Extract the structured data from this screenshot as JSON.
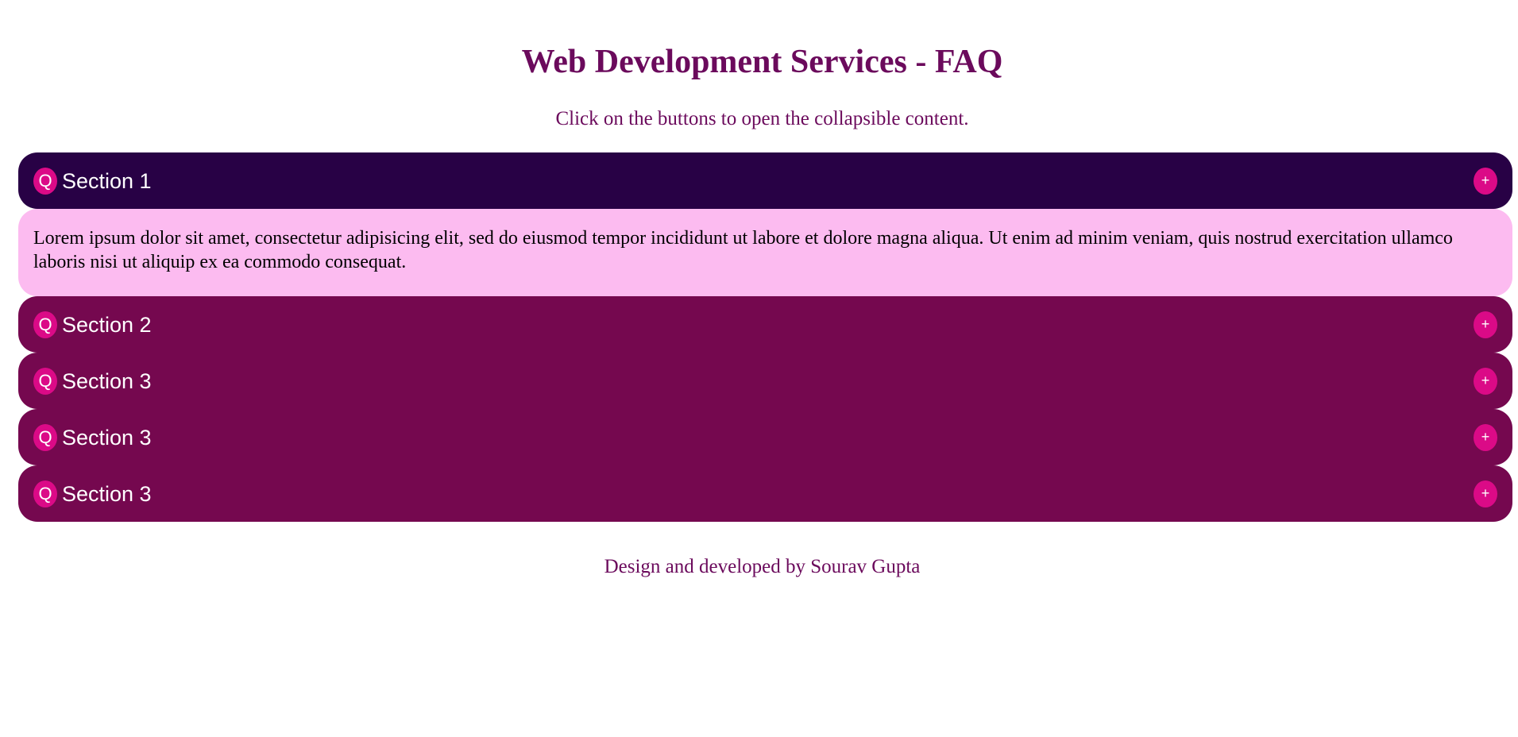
{
  "header": {
    "title": "Web Development Services - FAQ",
    "subtitle": "Click on the buttons to open the collapsible content."
  },
  "faq": {
    "q_icon_text": "Q",
    "toggle_icon_text": "+",
    "items": [
      {
        "label": "Section 1",
        "expanded": true,
        "content": "Lorem ipsum dolor sit amet, consectetur adipisicing elit, sed do eiusmod tempor incididunt ut labore et dolore magna aliqua. Ut enim ad minim veniam, quis nostrud exercitation ullamco laboris nisi ut aliquip ex ea commodo consequat."
      },
      {
        "label": "Section 2",
        "expanded": false
      },
      {
        "label": "Section 3",
        "expanded": false
      },
      {
        "label": "Section 3",
        "expanded": false
      },
      {
        "label": "Section 3",
        "expanded": false
      }
    ]
  },
  "footer": {
    "text": "Design and developed by Sourav Gupta"
  },
  "colors": {
    "title": "#6b0a5c",
    "button": "#75084f",
    "button_active": "#280145",
    "badge": "#db0a87",
    "content_background": "#fcbbf0"
  }
}
